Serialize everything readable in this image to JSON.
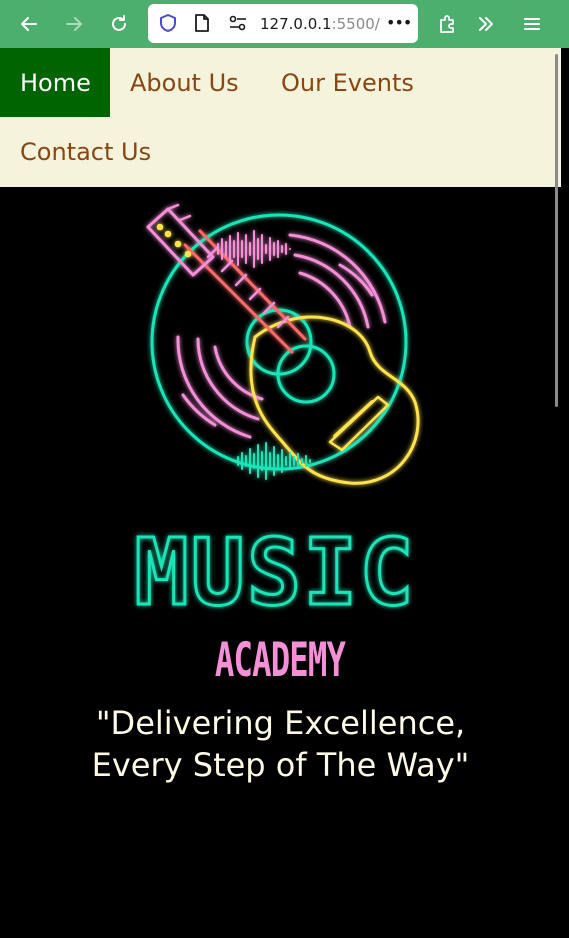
{
  "browser": {
    "url_main": "127.0.0.1",
    "url_rest": ":5500/",
    "url_dim": "/",
    "menu_ellipsis": "•••"
  },
  "nav": {
    "items": [
      {
        "label": "Home",
        "active": true
      },
      {
        "label": "About Us",
        "active": false
      },
      {
        "label": "Our Events",
        "active": false
      },
      {
        "label": "Contact Us",
        "active": false
      }
    ]
  },
  "logo": {
    "word1": "MUSIC",
    "word2": "ACADEMY"
  },
  "tagline": {
    "line1": "\"Delivering Excellence,",
    "line2": "Every Step of The Way\""
  },
  "colors": {
    "toolbar": "#4caf6e",
    "nav_bg": "#f5f3dc",
    "nav_text": "#8b4513",
    "nav_active_bg": "#006400",
    "neon_teal": "#19e6b8",
    "neon_pink": "#f48fd8",
    "neon_yellow": "#ffe34d",
    "neon_red": "#ff6b6b",
    "tagline": "#fffbe6"
  }
}
